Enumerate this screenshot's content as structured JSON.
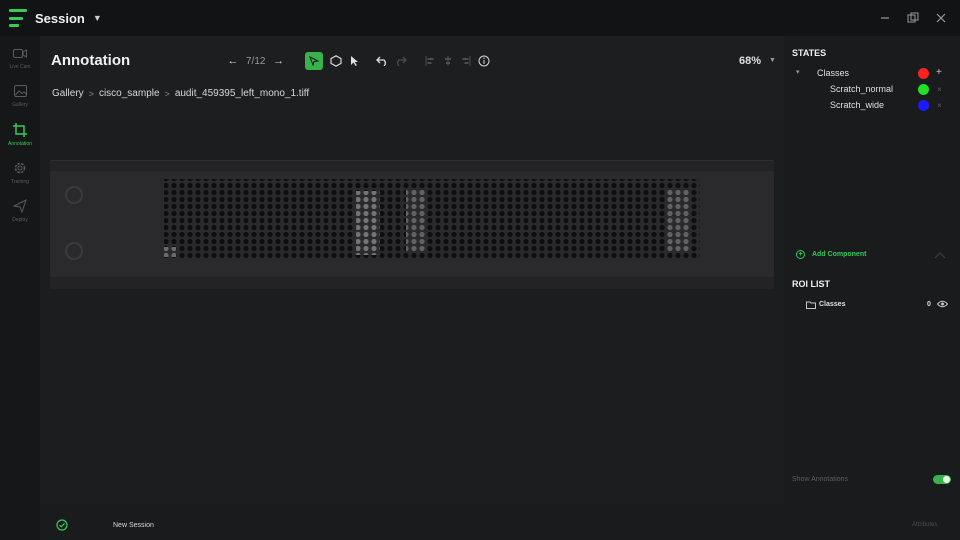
{
  "window": {
    "title": "Session"
  },
  "nav": {
    "items": [
      {
        "label": "Live Cam"
      },
      {
        "label": "Gallery"
      },
      {
        "label": "Annotation"
      },
      {
        "label": "Training"
      },
      {
        "label": "Deploy"
      }
    ]
  },
  "main": {
    "title": "Annotation",
    "page_counter": "7/12",
    "zoom": "68%",
    "breadcrumb": [
      "Gallery",
      "cisco_sample",
      "audit_459395_left_mono_1.tiff"
    ],
    "new_session_label": "New Session"
  },
  "states": {
    "title": "STATES",
    "classes_label": "Classes",
    "rows": [
      {
        "label": "Classes",
        "color": "#ff2020"
      },
      {
        "label": "Scratch_normal",
        "color": "#22e022"
      },
      {
        "label": "Scratch_wide",
        "color": "#1a1aff"
      }
    ]
  },
  "components": {
    "add_label": "Add Component"
  },
  "roi": {
    "title": "ROI LIST",
    "rows": [
      {
        "label": "Classes",
        "count": "0"
      }
    ]
  },
  "footer": {
    "show_annotations_label": "Show Annotations",
    "link_label": "Attributes"
  },
  "colors": {
    "accent": "#37c95a"
  }
}
